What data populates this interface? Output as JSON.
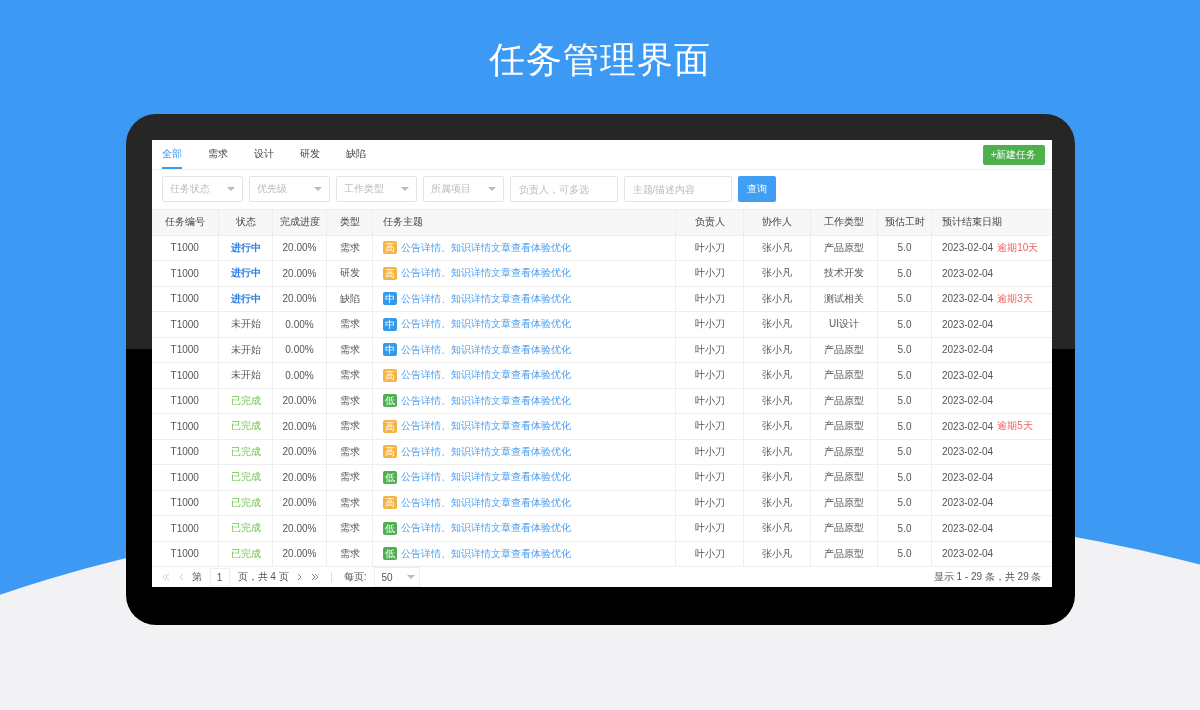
{
  "page_title": "任务管理界面",
  "tabs": [
    {
      "label": "全部",
      "selected": true
    },
    {
      "label": "需求",
      "selected": false
    },
    {
      "label": "设计",
      "selected": false
    },
    {
      "label": "研发",
      "selected": false
    },
    {
      "label": "缺陷",
      "selected": false
    }
  ],
  "new_button": "+新建任务",
  "filters": [
    {
      "kind": "select",
      "placeholder": "任务状态"
    },
    {
      "kind": "select",
      "placeholder": "优先级"
    },
    {
      "kind": "select",
      "placeholder": "工作类型"
    },
    {
      "kind": "select",
      "placeholder": "所属项目"
    },
    {
      "kind": "input",
      "placeholder": "负责人，可多选"
    },
    {
      "kind": "input",
      "placeholder": "主题/描述内容"
    }
  ],
  "search_button": "查询",
  "table": {
    "columns": [
      "任务编号",
      "状态",
      "完成进度",
      "类型",
      "任务主题",
      "负责人",
      "协作人",
      "工作类型",
      "预估工时",
      "预计结束日期"
    ],
    "rows": [
      {
        "id": "T1000",
        "status": {
          "text": "进行中",
          "kind": "progress"
        },
        "progress": "20.00%",
        "type": "需求",
        "priority": {
          "text": "高",
          "kind": "high"
        },
        "title": "公告详情、知识详情文章查看体验优化",
        "owner": "叶小刀",
        "helper": "张小凡",
        "work_type": "产品原型",
        "hours": "5.0",
        "end_date": "2023-02-04",
        "overdue": "逾期10天"
      },
      {
        "id": "T1000",
        "status": {
          "text": "进行中",
          "kind": "progress"
        },
        "progress": "20.00%",
        "type": "研发",
        "priority": {
          "text": "高",
          "kind": "high"
        },
        "title": "公告详情、知识详情文章查看体验优化",
        "owner": "叶小刀",
        "helper": "张小凡",
        "work_type": "技术开发",
        "hours": "5.0",
        "end_date": "2023-02-04"
      },
      {
        "id": "T1000",
        "status": {
          "text": "进行中",
          "kind": "progress"
        },
        "progress": "20.00%",
        "type": "缺陷",
        "priority": {
          "text": "中",
          "kind": "mid"
        },
        "title": "公告详情、知识详情文章查看体验优化",
        "owner": "叶小刀",
        "helper": "张小凡",
        "work_type": "测试相关",
        "hours": "5.0",
        "end_date": "2023-02-04",
        "overdue": "逾期3天"
      },
      {
        "id": "T1000",
        "status": {
          "text": "未开始",
          "kind": "todo"
        },
        "progress": "0.00%",
        "type": "需求",
        "priority": {
          "text": "中",
          "kind": "mid"
        },
        "title": "公告详情、知识详情文章查看体验优化",
        "owner": "叶小刀",
        "helper": "张小凡",
        "work_type": "UI设计",
        "hours": "5.0",
        "end_date": "2023-02-04"
      },
      {
        "id": "T1000",
        "status": {
          "text": "未开始",
          "kind": "todo"
        },
        "progress": "0.00%",
        "type": "需求",
        "priority": {
          "text": "中",
          "kind": "mid"
        },
        "title": "公告详情、知识详情文章查看体验优化",
        "owner": "叶小刀",
        "helper": "张小凡",
        "work_type": "产品原型",
        "hours": "5.0",
        "end_date": "2023-02-04"
      },
      {
        "id": "T1000",
        "status": {
          "text": "未开始",
          "kind": "todo"
        },
        "progress": "0.00%",
        "type": "需求",
        "priority": {
          "text": "高",
          "kind": "high"
        },
        "title": "公告详情、知识详情文章查看体验优化",
        "owner": "叶小刀",
        "helper": "张小凡",
        "work_type": "产品原型",
        "hours": "5.0",
        "end_date": "2023-02-04"
      },
      {
        "id": "T1000",
        "status": {
          "text": "已完成",
          "kind": "done"
        },
        "progress": "20.00%",
        "type": "需求",
        "priority": {
          "text": "低",
          "kind": "low"
        },
        "title": "公告详情、知识详情文章查看体验优化",
        "owner": "叶小刀",
        "helper": "张小凡",
        "work_type": "产品原型",
        "hours": "5.0",
        "end_date": "2023-02-04"
      },
      {
        "id": "T1000",
        "status": {
          "text": "已完成",
          "kind": "done"
        },
        "progress": "20.00%",
        "type": "需求",
        "priority": {
          "text": "高",
          "kind": "high"
        },
        "title": "公告详情、知识详情文章查看体验优化",
        "owner": "叶小刀",
        "helper": "张小凡",
        "work_type": "产品原型",
        "hours": "5.0",
        "end_date": "2023-02-04",
        "overdue": "逾期5天"
      },
      {
        "id": "T1000",
        "status": {
          "text": "已完成",
          "kind": "done"
        },
        "progress": "20.00%",
        "type": "需求",
        "priority": {
          "text": "高",
          "kind": "high"
        },
        "title": "公告详情、知识详情文章查看体验优化",
        "owner": "叶小刀",
        "helper": "张小凡",
        "work_type": "产品原型",
        "hours": "5.0",
        "end_date": "2023-02-04"
      },
      {
        "id": "T1000",
        "status": {
          "text": "已完成",
          "kind": "done"
        },
        "progress": "20.00%",
        "type": "需求",
        "priority": {
          "text": "低",
          "kind": "low"
        },
        "title": "公告详情、知识详情文章查看体验优化",
        "owner": "叶小刀",
        "helper": "张小凡",
        "work_type": "产品原型",
        "hours": "5.0",
        "end_date": "2023-02-04"
      },
      {
        "id": "T1000",
        "status": {
          "text": "已完成",
          "kind": "done"
        },
        "progress": "20.00%",
        "type": "需求",
        "priority": {
          "text": "高",
          "kind": "high"
        },
        "title": "公告详情、知识详情文章查看体验优化",
        "owner": "叶小刀",
        "helper": "张小凡",
        "work_type": "产品原型",
        "hours": "5.0",
        "end_date": "2023-02-04"
      },
      {
        "id": "T1000",
        "status": {
          "text": "已完成",
          "kind": "done"
        },
        "progress": "20.00%",
        "type": "需求",
        "priority": {
          "text": "低",
          "kind": "low"
        },
        "title": "公告详情、知识详情文章查看体验优化",
        "owner": "叶小刀",
        "helper": "张小凡",
        "work_type": "产品原型",
        "hours": "5.0",
        "end_date": "2023-02-04"
      },
      {
        "id": "T1000",
        "status": {
          "text": "已完成",
          "kind": "done"
        },
        "progress": "20.00%",
        "type": "需求",
        "priority": {
          "text": "低",
          "kind": "low"
        },
        "title": "公告详情、知识详情文章查看体验优化",
        "owner": "叶小刀",
        "helper": "张小凡",
        "work_type": "产品原型",
        "hours": "5.0",
        "end_date": "2023-02-04"
      }
    ]
  },
  "pagination": {
    "page_prefix": "第",
    "page": "1",
    "page_suffix": "页，共 4 页",
    "per_page_label": "每页:",
    "per_page": "50",
    "summary": "显示 1 - 29 条，共 29 条"
  }
}
